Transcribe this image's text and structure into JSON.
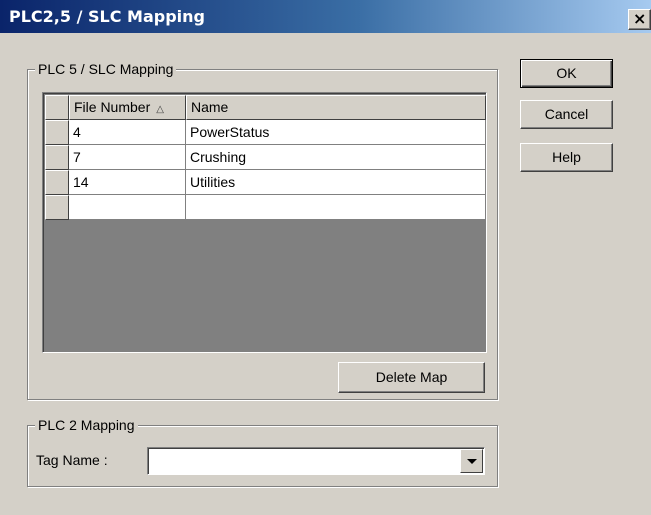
{
  "window": {
    "title": "PLC2,5 / SLC Mapping",
    "close_glyph": "×"
  },
  "plc5_group": {
    "legend": "PLC 5 / SLC Mapping",
    "columns": {
      "file_number": "File Number",
      "name": "Name",
      "sort_glyph": "△"
    },
    "rows": [
      {
        "file_number": "4",
        "name": "PowerStatus"
      },
      {
        "file_number": "7",
        "name": "Crushing"
      },
      {
        "file_number": "14",
        "name": "Utilities"
      },
      {
        "file_number": "",
        "name": ""
      }
    ],
    "delete_map_label": "Delete Map"
  },
  "plc2_group": {
    "legend": "PLC 2 Mapping",
    "tag_name_label": "Tag Name :",
    "tag_name_value": ""
  },
  "buttons": {
    "ok": "OK",
    "cancel": "Cancel",
    "help": "Help"
  }
}
